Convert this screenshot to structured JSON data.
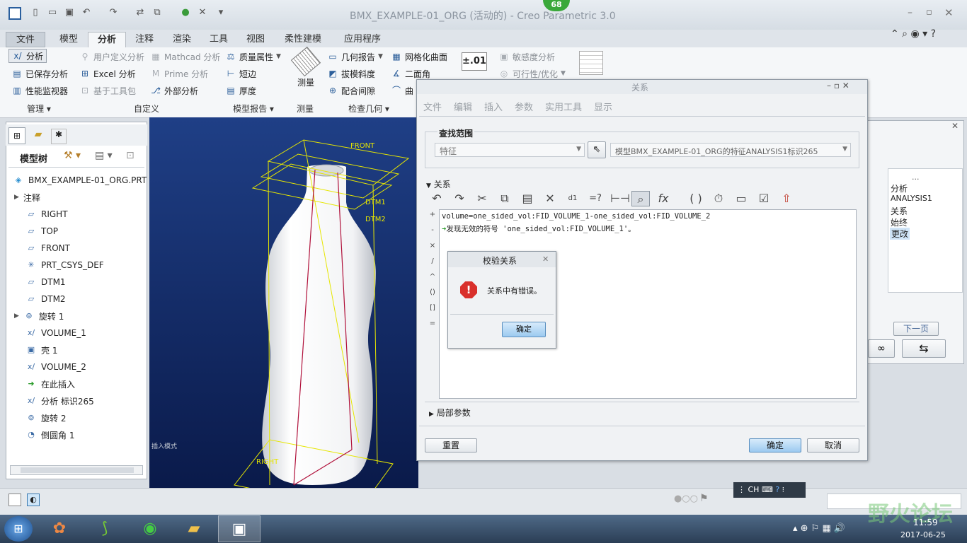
{
  "window": {
    "title": "BMX_EXAMPLE-01_ORG (活动的) - Creo Parametric 3.0",
    "badge": "68"
  },
  "ribbon": {
    "tabs": [
      "文件",
      "模型",
      "分析",
      "注释",
      "渲染",
      "工具",
      "视图",
      "柔性建模",
      "应用程序"
    ],
    "active_tab": "分析",
    "col1": [
      "分析",
      "已保存分析",
      "性能监视器"
    ],
    "col2": [
      "用户定义分析",
      "Excel 分析",
      "基于工具包"
    ],
    "col3": [
      "Mathcad 分析",
      "Prime 分析",
      "外部分析"
    ],
    "col4": [
      "质量属性",
      "短边",
      "厚度"
    ],
    "measure": "测量",
    "col5": [
      "几何报告",
      "拔模斜度",
      "配合间隙"
    ],
    "col6": [
      "网格化曲面",
      "二面角",
      "曲"
    ],
    "col7": [
      "敏感度分析",
      "可行性/优化"
    ],
    "tolerance_label": "±.01",
    "groups": [
      "管理",
      "自定义",
      "模型报告",
      "测量",
      "检查几何"
    ]
  },
  "model_tree": {
    "title": "模型树",
    "root": "BMX_EXAMPLE-01_ORG.PRT",
    "items": [
      "注释",
      "RIGHT",
      "TOP",
      "FRONT",
      "PRT_CSYS_DEF",
      "DTM1",
      "DTM2",
      "旋转 1",
      "VOLUME_1",
      "壳 1",
      "VOLUME_2",
      "在此插入",
      "分析 标识265",
      "旋转 2",
      "倒圆角 1"
    ]
  },
  "viewport": {
    "labels": [
      "FRONT",
      "DTM1",
      "DTM2",
      "RIGHT"
    ],
    "status": "插入模式"
  },
  "dialog": {
    "title": "关系",
    "menu": [
      "文件",
      "编辑",
      "插入",
      "参数",
      "实用工具",
      "显示"
    ],
    "lookup_title": "查找范围",
    "lookup_type": "特征",
    "lookup_value": "模型BMX_EXAMPLE-01_ORG的特征ANALYSIS1标识265",
    "relations_title": "关系",
    "relation_line": "volume=one_sided_vol:FID_VOLUME_1-one_sided_vol:FID_VOLUME_2",
    "error_line": "发现无效的符号 'one_sided_vol:FID_VOLUME_1'。",
    "side_ops": [
      "+",
      "-",
      "×",
      "/",
      "^",
      "()",
      "[]",
      "="
    ],
    "local_params": "局部参数",
    "reset": "重置",
    "ok": "确定",
    "cancel": "取消"
  },
  "verify": {
    "title": "校验关系",
    "message": "关系中有错误。",
    "ok": "确定"
  },
  "bg_panel": {
    "header": "...",
    "items": [
      "分析",
      "ANALYSIS1",
      "关系",
      "始终",
      "更改"
    ],
    "next": "下一页"
  },
  "taskbar": {
    "ime": "CH",
    "time": "11:59",
    "date": "2017-06-25",
    "watermark": "野火论坛"
  }
}
